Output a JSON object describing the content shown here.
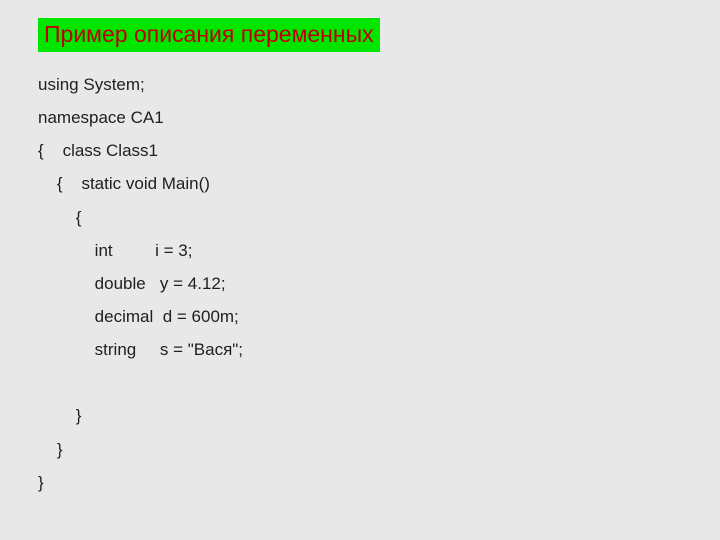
{
  "title": "Пример описания переменных",
  "code": {
    "l1": "using System;",
    "l2": "namespace CA1",
    "l3": "{    class Class1",
    "l4": "    {    static void Main()",
    "l5": "        {",
    "l6": "            int         i = 3;",
    "l7": "            double   y = 4.12;",
    "l8": "            decimal  d = 600m;",
    "l9": "            string     s = \"Вася\";",
    "l10": "        }",
    "l11": "    }",
    "l12": "}"
  }
}
